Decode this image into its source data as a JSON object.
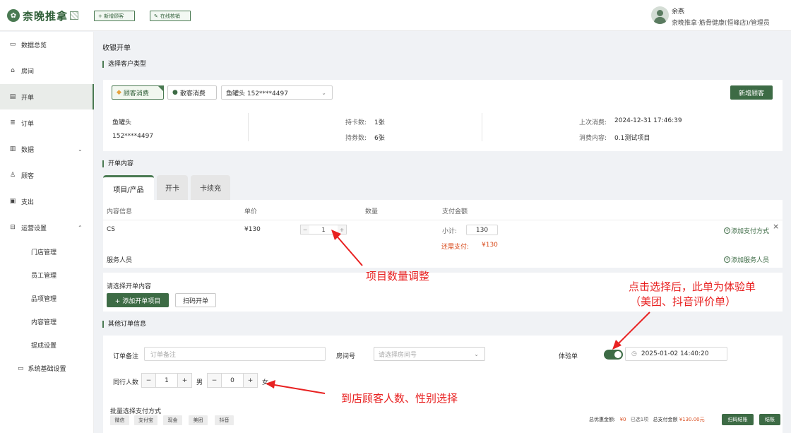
{
  "header": {
    "logo_text": "柰晚推拿",
    "btn_new_customer": "+ 新增顾客",
    "btn_online_verify": "在线核销",
    "user_name": "余燕",
    "user_role": "柰晚推拿·筋骨健康(恒峰店)/管理员"
  },
  "sidebar": {
    "items": [
      {
        "label": "数据总览",
        "icon": "monitor-icon"
      },
      {
        "label": "房间",
        "icon": "home-icon"
      },
      {
        "label": "开单",
        "icon": "document-icon"
      },
      {
        "label": "订单",
        "icon": "list-icon"
      },
      {
        "label": "数据",
        "icon": "chart-icon"
      },
      {
        "label": "顾客",
        "icon": "user-icon"
      },
      {
        "label": "支出",
        "icon": "wallet-icon"
      },
      {
        "label": "运营设置",
        "icon": "settings-icon"
      }
    ],
    "sub_items": [
      "门店管理",
      "员工管理",
      "品项管理",
      "内容管理",
      "提成设置"
    ],
    "system_settings": "系统基础设置"
  },
  "page": {
    "title": "收银开单",
    "section_customer_type": "选择客户类型",
    "customer_type_member": "顾客消费",
    "customer_type_guest": "散客消费",
    "customer_select_value": "鱼罐头 152****4497",
    "new_customer_btn": "新增顾客",
    "customer": {
      "name": "鱼罐头",
      "phone": "152****4497",
      "card_count_label": "持卡数:",
      "card_count": "1张",
      "coupon_count_label": "持券数:",
      "coupon_count": "6张",
      "last_consume_label": "上次消费:",
      "last_consume": "2024-12-31 17:46:39",
      "consume_content_label": "消费内容:",
      "consume_content": "0.1测试项目"
    },
    "section_order_content": "开单内容",
    "tabs": [
      "项目/产品",
      "开卡",
      "卡续充"
    ],
    "table_headers": [
      "内容信息",
      "单价",
      "数量",
      "支付金额"
    ],
    "item": {
      "name": "CS",
      "price": "¥130",
      "qty": "1",
      "subtotal_label": "小计:",
      "subtotal": "130",
      "due_label": "还需支付:",
      "due": "¥130",
      "add_payment": "添加支付方式",
      "service_staff_label": "服务人员",
      "add_staff": "添加服务人员"
    },
    "choose_content_label": "请选择开单内容",
    "add_item_btn": "+ 添加开单项目",
    "scan_btn": "扫码开单",
    "section_other": "其他订单信息",
    "remark_label": "订单备注",
    "remark_placeholder": "订单备注",
    "room_label": "房间号",
    "room_placeholder": "请选择房间号",
    "trial_label": "体验单",
    "trial_datetime": "2025-01-02 14:40:20",
    "companions_label": "同行人数",
    "male_count": "1",
    "male_label": "男",
    "female_count": "0",
    "female_label": "女",
    "batch_pay_label": "批量选择支付方式",
    "pay_methods": [
      "微信",
      "支付宝",
      "现金",
      "美团",
      "抖音"
    ],
    "footer": {
      "discount_label": "总优惠金额:",
      "discount_value": "¥0",
      "selected_label": "已选",
      "selected_value": "1项",
      "total_label": "总支付金额",
      "total_value": "¥130.00元",
      "scan_pay_btn": "扫码结账",
      "checkout_btn": "结账"
    }
  },
  "annotations": {
    "qty_adjust": "项目数量调整",
    "trial_line1": "点击选择后，此单为体验单",
    "trial_line2": "（美团、抖音评价单）",
    "gender_select": "到店顾客人数、性别选择"
  },
  "colors": {
    "brand_green": "#3d6b45",
    "annotation_red": "#e82121",
    "due_orange": "#d84a1b"
  }
}
